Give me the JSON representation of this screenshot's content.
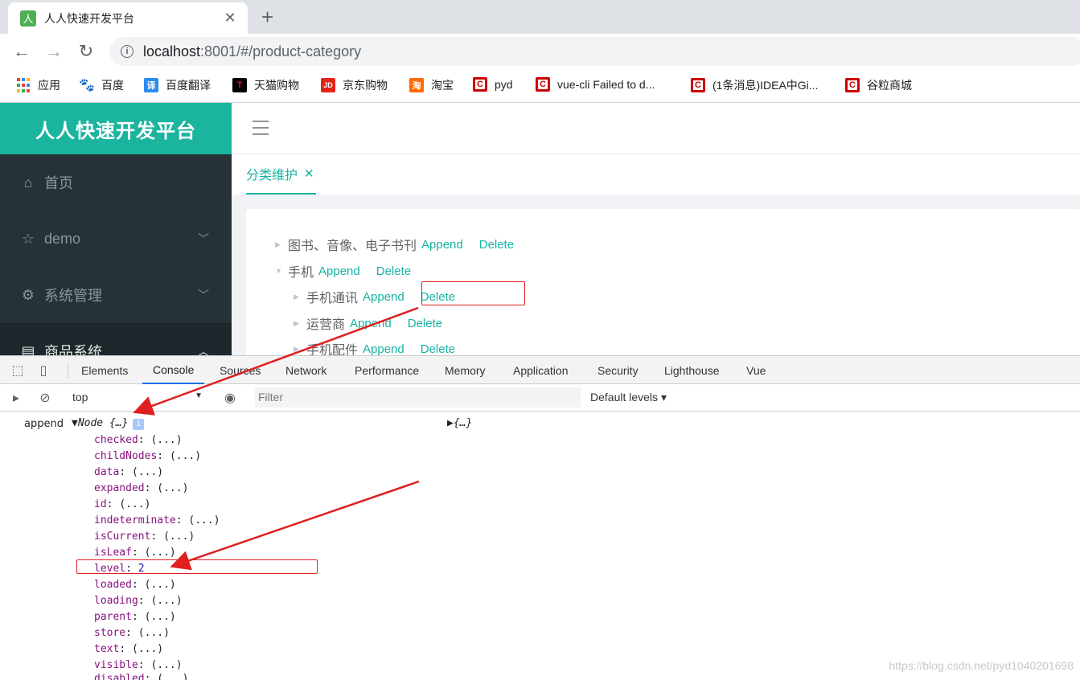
{
  "browser": {
    "tab_title": "人人快速开发平台",
    "favicon_text": "人",
    "url_host": "localhost",
    "url_rest": ":8001/#/product-category",
    "bookmarks": [
      {
        "label": "应用",
        "icon": "apps-grid-icon"
      },
      {
        "label": "百度",
        "icon": "baidu-paw-icon"
      },
      {
        "label": "百度翻译",
        "icon": "translate-icon",
        "glyph": "译"
      },
      {
        "label": "天猫购物",
        "icon": "tmall-icon",
        "glyph": "T"
      },
      {
        "label": "京东购物",
        "icon": "jd-icon",
        "glyph": "JD"
      },
      {
        "label": "淘宝",
        "icon": "taobao-icon",
        "glyph": "淘"
      },
      {
        "label": "pyd",
        "icon": "csdn-icon",
        "glyph": "C"
      },
      {
        "label": "vue-cli Failed to d...",
        "icon": "csdn-icon",
        "glyph": "C"
      },
      {
        "label": "(1条消息)IDEA中Gi...",
        "icon": "csdn-icon",
        "glyph": "C"
      },
      {
        "label": "谷粒商城",
        "icon": "csdn-icon",
        "glyph": "C"
      }
    ]
  },
  "app": {
    "brand": "人人快速开发平台",
    "menu": [
      {
        "label": "首页",
        "icon": "home-icon"
      },
      {
        "label": "demo",
        "icon": "star-icon"
      },
      {
        "label": "系统管理",
        "icon": "gear-icon"
      },
      {
        "label": "商品系统",
        "icon": "document-icon"
      }
    ],
    "active_tab": "分类维护",
    "tree": {
      "append_label": "Append",
      "delete_label": "Delete",
      "nodes": [
        {
          "label": "图书、音像、电子书刊",
          "expanded": false,
          "level": 1
        },
        {
          "label": "手机",
          "expanded": true,
          "level": 1
        },
        {
          "label": "手机通讯",
          "expanded": false,
          "level": 2
        },
        {
          "label": "运营商",
          "expanded": false,
          "level": 2
        },
        {
          "label": "手机配件",
          "expanded": false,
          "level": 2
        }
      ]
    }
  },
  "devtools": {
    "tabs": [
      "Elements",
      "Console",
      "Sources",
      "Network",
      "Performance",
      "Memory",
      "Application",
      "Security",
      "Lighthouse",
      "Vue"
    ],
    "selected_tab": "Console",
    "context": "top",
    "filter_placeholder": "Filter",
    "levels": "Default levels",
    "console": {
      "label": "append",
      "object_preview": "Node {…}",
      "right_preview": "{…}",
      "props": [
        {
          "key": "checked",
          "value": "(...)"
        },
        {
          "key": "childNodes",
          "value": "(...)"
        },
        {
          "key": "data",
          "value": "(...)"
        },
        {
          "key": "expanded",
          "value": "(...)"
        },
        {
          "key": "id",
          "value": "(...)"
        },
        {
          "key": "indeterminate",
          "value": "(...)"
        },
        {
          "key": "isCurrent",
          "value": "(...)"
        },
        {
          "key": "isLeaf",
          "value": "(...)"
        },
        {
          "key": "level",
          "value": "2"
        },
        {
          "key": "loaded",
          "value": "(...)"
        },
        {
          "key": "loading",
          "value": "(...)"
        },
        {
          "key": "parent",
          "value": "(...)"
        },
        {
          "key": "store",
          "value": "(...)"
        },
        {
          "key": "text",
          "value": "(...)"
        },
        {
          "key": "visible",
          "value": "(...)"
        },
        {
          "key": "disabled",
          "value": "(...)"
        }
      ]
    }
  },
  "watermark": "https://blog.csdn.net/pyd1040201698",
  "colors": {
    "accent": "#17b3a3",
    "annotation": "#e02020"
  }
}
